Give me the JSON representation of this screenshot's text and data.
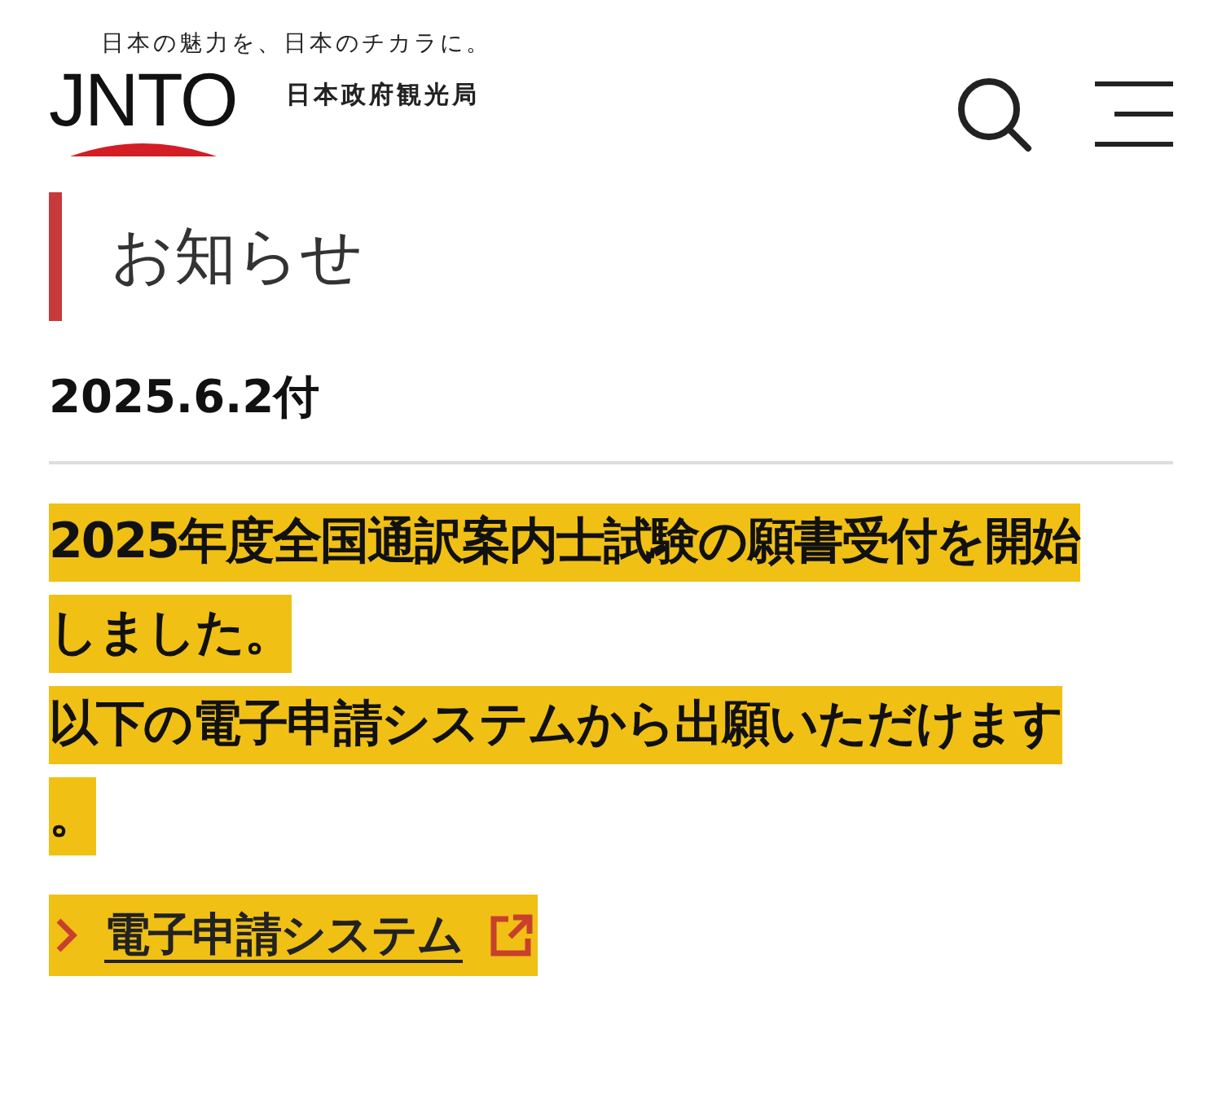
{
  "header": {
    "tagline": "日本の魅力を、日本のチカラに。",
    "logo": "JNTO",
    "org": "日本政府観光局"
  },
  "heading": "お知らせ",
  "date": "2025.6.2付",
  "lines": [
    "2025年度全国通訳案内士試験の願書受付を開始",
    "しました。",
    "以下の電子申請システムから出願いただけます",
    "。"
  ],
  "link": {
    "label": "電子申請システム"
  }
}
